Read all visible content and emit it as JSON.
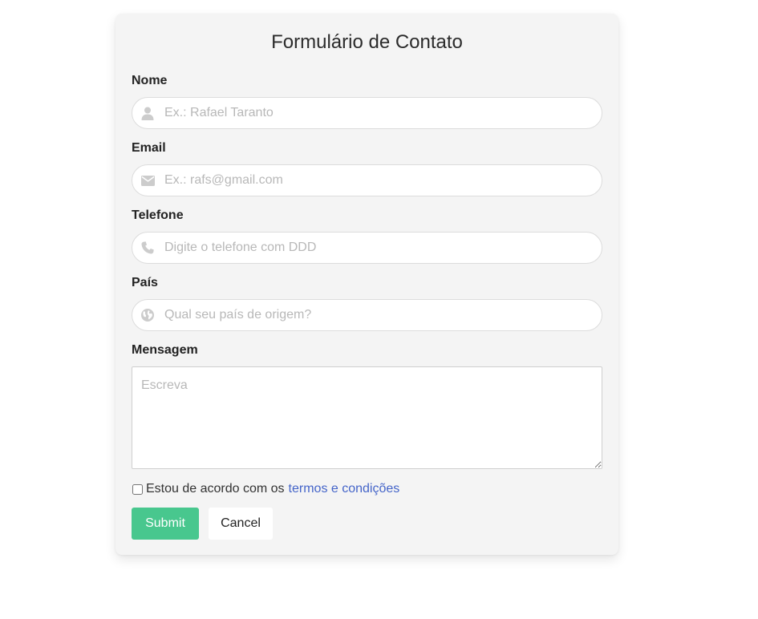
{
  "form": {
    "title": "Formulário de Contato",
    "fields": {
      "nome": {
        "label": "Nome",
        "placeholder": "Ex.: Rafael Taranto",
        "value": "",
        "icon": "user-icon"
      },
      "email": {
        "label": "Email",
        "placeholder": "Ex.: rafs@gmail.com",
        "value": "",
        "icon": "envelope-icon"
      },
      "telefone": {
        "label": "Telefone",
        "placeholder": "Digite o telefone com DDD",
        "value": "",
        "icon": "phone-icon"
      },
      "pais": {
        "label": "País",
        "placeholder": "Qual seu país de origem?",
        "value": "",
        "icon": "globe-icon"
      },
      "mensagem": {
        "label": "Mensagem",
        "placeholder": "Escreva",
        "value": ""
      }
    },
    "agreement": {
      "text": "Estou de acordo com os",
      "link_text": "termos e condições",
      "checked": false
    },
    "buttons": {
      "submit": "Submit",
      "cancel": "Cancel"
    }
  },
  "colors": {
    "card_background": "#f4f4f4",
    "submit_background": "#48c78e",
    "link": "#4565c9",
    "icon": "#cccccc",
    "placeholder": "#b8b8b8"
  }
}
